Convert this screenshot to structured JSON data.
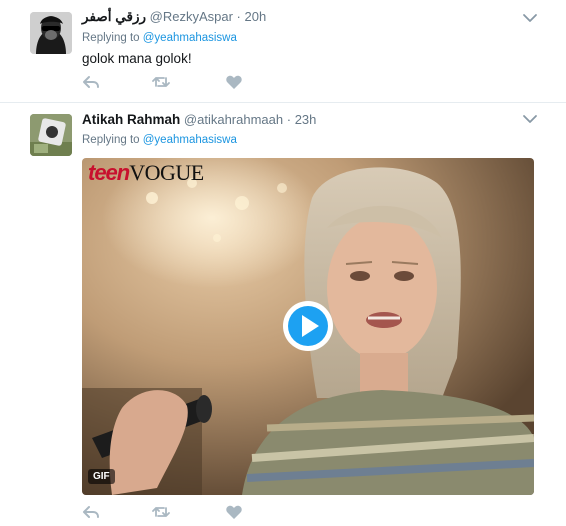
{
  "tweets": [
    {
      "fullname": "رزقي أصفر",
      "username": "@RezkyAspar",
      "separator": "·",
      "time": "20h",
      "replying_prefix": "Replying to",
      "replying_to": "@yeahmahasiswa",
      "text": "golok mana golok!"
    },
    {
      "fullname": "Atikah Rahmah",
      "username": "@atikahrahmaah",
      "separator": "·",
      "time": "23h",
      "replying_prefix": "Replying to",
      "replying_to": "@yeahmahasiswa",
      "media": {
        "brand_teen": "teen",
        "brand_vogue": "VOGUE",
        "badge": "GIF"
      }
    }
  ],
  "icons": {
    "chevron": "chevron-down-icon",
    "reply": "reply-icon",
    "retweet": "retweet-icon",
    "like": "heart-icon",
    "play": "play-icon"
  },
  "colors": {
    "link": "#1b95e0",
    "muted": "#657786",
    "action": "#aab8c2",
    "text": "#14171a"
  }
}
